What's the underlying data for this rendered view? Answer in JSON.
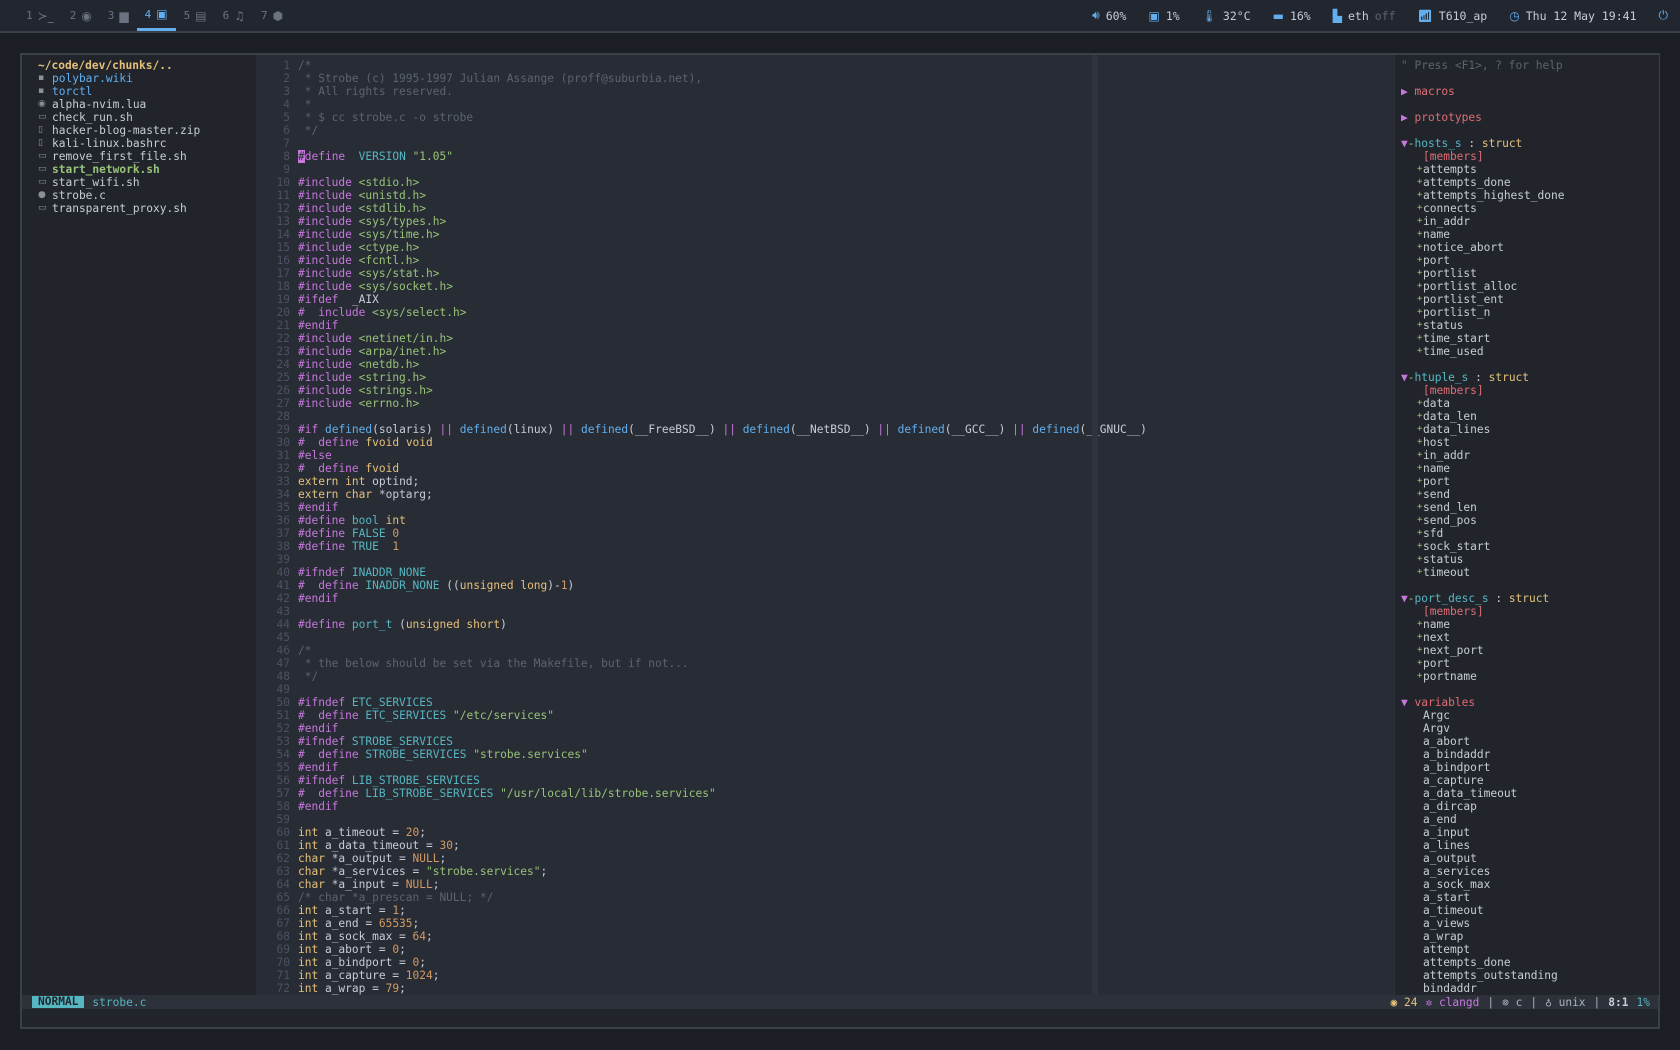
{
  "workspaces": [
    {
      "num": "1",
      "icon": "terminal-icon",
      "glyph": "≻_",
      "active": false
    },
    {
      "num": "2",
      "icon": "firefox-icon",
      "glyph": "◉",
      "active": false
    },
    {
      "num": "3",
      "icon": "folder-icon",
      "glyph": "▆",
      "active": false
    },
    {
      "num": "4",
      "icon": "code-icon",
      "glyph": "▣",
      "active": true
    },
    {
      "num": "5",
      "icon": "book-icon",
      "glyph": "▤",
      "active": false
    },
    {
      "num": "6",
      "icon": "music-icon",
      "glyph": "♫",
      "active": false
    },
    {
      "num": "7",
      "icon": "box-icon",
      "glyph": "⬢",
      "active": false
    }
  ],
  "status": {
    "volume": "60%",
    "cpu": "1%",
    "temp": "32°C",
    "memory": "16%",
    "eth": "eth",
    "eth_state": "off",
    "wifi": "T610_ap",
    "clock": "Thu 12 May 19:41"
  },
  "tree": {
    "root": "~/code/dev/chunks/..",
    "files": [
      {
        "name": "polybar.wiki",
        "icon": "folder-icon",
        "glyph": "▪",
        "style": "c-blue"
      },
      {
        "name": "torctl",
        "icon": "folder-icon",
        "glyph": "▪",
        "style": "c-blue"
      },
      {
        "name": "alpha-nvim.lua",
        "icon": "lua-icon",
        "glyph": "◉",
        "style": "c-white"
      },
      {
        "name": "check_run.sh",
        "icon": "terminal-icon",
        "glyph": "▭",
        "style": "c-white"
      },
      {
        "name": "hacker-blog-master.zip",
        "icon": "file-icon",
        "glyph": "▯",
        "style": "c-white"
      },
      {
        "name": "kali-linux.bashrc",
        "icon": "file-icon",
        "glyph": "▯",
        "style": "c-white"
      },
      {
        "name": "remove_first_file.sh",
        "icon": "terminal-icon",
        "glyph": "▭",
        "style": "c-white"
      },
      {
        "name": "start_network.sh",
        "icon": "terminal-icon",
        "glyph": "▭",
        "style": "c-bold-green"
      },
      {
        "name": "start_wifi.sh",
        "icon": "terminal-icon",
        "glyph": "▭",
        "style": "c-white"
      },
      {
        "name": "strobe.c",
        "icon": "c-file-icon",
        "glyph": "●",
        "style": "c-white"
      },
      {
        "name": "transparent_proxy.sh",
        "icon": "terminal-icon",
        "glyph": "▭",
        "style": "c-white"
      }
    ]
  },
  "code": [
    [
      [
        "cm",
        "/*"
      ]
    ],
    [
      [
        "cm",
        " * Strobe (c) 1995-1997 Julian Assange (proff@suburbia.net),"
      ]
    ],
    [
      [
        "cm",
        " * All rights reserved."
      ]
    ],
    [
      [
        "cm",
        " *"
      ]
    ],
    [
      [
        "cm",
        " * $ cc strobe.c -o strobe"
      ]
    ],
    [
      [
        "cm",
        " */"
      ]
    ],
    [],
    [
      [
        "cursor",
        "#"
      ],
      [
        "kw",
        "define"
      ],
      [
        "",
        "  "
      ],
      [
        "mac",
        "VERSION"
      ],
      [
        "",
        " "
      ],
      [
        "st-s",
        "\"1.05\""
      ]
    ],
    [],
    [
      [
        "kw",
        "#include"
      ],
      [
        "",
        " "
      ],
      [
        "st-s",
        "<stdio.h>"
      ]
    ],
    [
      [
        "kw",
        "#include"
      ],
      [
        "",
        " "
      ],
      [
        "st-s",
        "<unistd.h>"
      ]
    ],
    [
      [
        "kw",
        "#include"
      ],
      [
        "",
        " "
      ],
      [
        "st-s",
        "<stdlib.h>"
      ]
    ],
    [
      [
        "kw",
        "#include"
      ],
      [
        "",
        " "
      ],
      [
        "st-s",
        "<sys/types.h>"
      ]
    ],
    [
      [
        "kw",
        "#include"
      ],
      [
        "",
        " "
      ],
      [
        "st-s",
        "<sys/time.h>"
      ]
    ],
    [
      [
        "kw",
        "#include"
      ],
      [
        "",
        " "
      ],
      [
        "st-s",
        "<ctype.h>"
      ]
    ],
    [
      [
        "kw",
        "#include"
      ],
      [
        "",
        " "
      ],
      [
        "st-s",
        "<fcntl.h>"
      ]
    ],
    [
      [
        "kw",
        "#include"
      ],
      [
        "",
        " "
      ],
      [
        "st-s",
        "<sys/stat.h>"
      ]
    ],
    [
      [
        "kw",
        "#include"
      ],
      [
        "",
        " "
      ],
      [
        "st-s",
        "<sys/socket.h>"
      ]
    ],
    [
      [
        "kw",
        "#ifdef"
      ],
      [
        "",
        "  _AIX"
      ]
    ],
    [
      [
        "kw",
        "#"
      ],
      [
        "",
        "  "
      ],
      [
        "kw",
        "include"
      ],
      [
        "",
        " "
      ],
      [
        "st-s",
        "<sys/select.h>"
      ]
    ],
    [
      [
        "kw",
        "#endif"
      ]
    ],
    [
      [
        "kw",
        "#include"
      ],
      [
        "",
        " "
      ],
      [
        "st-s",
        "<netinet/in.h>"
      ]
    ],
    [
      [
        "kw",
        "#include"
      ],
      [
        "",
        " "
      ],
      [
        "st-s",
        "<arpa/inet.h>"
      ]
    ],
    [
      [
        "kw",
        "#include"
      ],
      [
        "",
        " "
      ],
      [
        "st-s",
        "<netdb.h>"
      ]
    ],
    [
      [
        "kw",
        "#include"
      ],
      [
        "",
        " "
      ],
      [
        "st-s",
        "<string.h>"
      ]
    ],
    [
      [
        "kw",
        "#include"
      ],
      [
        "",
        " "
      ],
      [
        "st-s",
        "<strings.h>"
      ]
    ],
    [
      [
        "kw",
        "#include"
      ],
      [
        "",
        " "
      ],
      [
        "st-s",
        "<errno.h>"
      ]
    ],
    [],
    [
      [
        "kw",
        "#if"
      ],
      [
        "",
        " "
      ],
      [
        "fn",
        "defined"
      ],
      [
        "",
        "(solaris) "
      ],
      [
        "kw",
        "||"
      ],
      [
        "",
        " "
      ],
      [
        "fn",
        "defined"
      ],
      [
        "",
        "(linux) "
      ],
      [
        "kw",
        "||"
      ],
      [
        "",
        " "
      ],
      [
        "fn",
        "defined"
      ],
      [
        "",
        "(__FreeBSD__) "
      ],
      [
        "kw",
        "||"
      ],
      [
        "",
        " "
      ],
      [
        "fn",
        "defined"
      ],
      [
        "",
        "(__NetBSD__) "
      ],
      [
        "kw",
        "||"
      ],
      [
        "",
        " "
      ],
      [
        "fn",
        "defined"
      ],
      [
        "",
        "(__GCC__) "
      ],
      [
        "kw",
        "||"
      ],
      [
        "",
        " "
      ],
      [
        "fn",
        "defined"
      ],
      [
        "",
        "(__GNUC__)"
      ]
    ],
    [
      [
        "kw",
        "#"
      ],
      [
        "",
        "  "
      ],
      [
        "kw",
        "define"
      ],
      [
        "",
        " "
      ],
      [
        "ty",
        "fvoid void"
      ]
    ],
    [
      [
        "kw",
        "#else"
      ]
    ],
    [
      [
        "kw",
        "#"
      ],
      [
        "",
        "  "
      ],
      [
        "kw",
        "define"
      ],
      [
        "",
        " "
      ],
      [
        "ty",
        "fvoid"
      ]
    ],
    [
      [
        "ty",
        "extern"
      ],
      [
        "",
        " "
      ],
      [
        "ty",
        "int"
      ],
      [
        "",
        " optind;"
      ]
    ],
    [
      [
        "ty",
        "extern"
      ],
      [
        "",
        " "
      ],
      [
        "ty",
        "char"
      ],
      [
        "",
        " *optarg;"
      ]
    ],
    [
      [
        "kw",
        "#endif"
      ]
    ],
    [
      [
        "kw",
        "#define"
      ],
      [
        "",
        " "
      ],
      [
        "mac",
        "bool"
      ],
      [
        "",
        " "
      ],
      [
        "ty",
        "int"
      ]
    ],
    [
      [
        "kw",
        "#define"
      ],
      [
        "",
        " "
      ],
      [
        "mac",
        "FALSE"
      ],
      [
        "",
        " "
      ],
      [
        "nm",
        "0"
      ]
    ],
    [
      [
        "kw",
        "#define"
      ],
      [
        "",
        " "
      ],
      [
        "mac",
        "TRUE"
      ],
      [
        "",
        "  "
      ],
      [
        "nm",
        "1"
      ]
    ],
    [],
    [
      [
        "kw",
        "#ifndef"
      ],
      [
        "",
        " "
      ],
      [
        "mac",
        "INADDR_NONE"
      ]
    ],
    [
      [
        "kw",
        "#"
      ],
      [
        "",
        "  "
      ],
      [
        "kw",
        "define"
      ],
      [
        "",
        " "
      ],
      [
        "mac",
        "INADDR_NONE"
      ],
      [
        "",
        " (("
      ],
      [
        "ty",
        "unsigned long"
      ],
      [
        "",
        ")-"
      ],
      [
        "nm",
        "1"
      ],
      [
        "",
        ")"
      ]
    ],
    [
      [
        "kw",
        "#endif"
      ]
    ],
    [],
    [
      [
        "kw",
        "#define"
      ],
      [
        "",
        " "
      ],
      [
        "mac",
        "port_t"
      ],
      [
        "",
        " ("
      ],
      [
        "ty",
        "unsigned short"
      ],
      [
        "",
        ")"
      ]
    ],
    [],
    [
      [
        "cm",
        "/*"
      ]
    ],
    [
      [
        "cm",
        " * the below should be set via the Makefile, but if not..."
      ]
    ],
    [
      [
        "cm",
        " */"
      ]
    ],
    [],
    [
      [
        "kw",
        "#ifndef"
      ],
      [
        "",
        " "
      ],
      [
        "mac",
        "ETC_SERVICES"
      ]
    ],
    [
      [
        "kw",
        "#"
      ],
      [
        "",
        "  "
      ],
      [
        "kw",
        "define"
      ],
      [
        "",
        " "
      ],
      [
        "mac",
        "ETC_SERVICES"
      ],
      [
        "",
        " "
      ],
      [
        "st-s",
        "\"/etc/services\""
      ]
    ],
    [
      [
        "kw",
        "#endif"
      ]
    ],
    [
      [
        "kw",
        "#ifndef"
      ],
      [
        "",
        " "
      ],
      [
        "mac",
        "STROBE_SERVICES"
      ]
    ],
    [
      [
        "kw",
        "#"
      ],
      [
        "",
        "  "
      ],
      [
        "kw",
        "define"
      ],
      [
        "",
        " "
      ],
      [
        "mac",
        "STROBE_SERVICES"
      ],
      [
        "",
        " "
      ],
      [
        "st-s",
        "\"strobe.services\""
      ]
    ],
    [
      [
        "kw",
        "#endif"
      ]
    ],
    [
      [
        "kw",
        "#ifndef"
      ],
      [
        "",
        " "
      ],
      [
        "mac",
        "LIB_STROBE_SERVICES"
      ]
    ],
    [
      [
        "kw",
        "#"
      ],
      [
        "",
        "  "
      ],
      [
        "kw",
        "define"
      ],
      [
        "",
        " "
      ],
      [
        "mac",
        "LIB_STROBE_SERVICES"
      ],
      [
        "",
        " "
      ],
      [
        "st-s",
        "\"/usr/local/lib/strobe.services\""
      ]
    ],
    [
      [
        "kw",
        "#endif"
      ]
    ],
    [],
    [
      [
        "ty",
        "int"
      ],
      [
        "",
        " a_timeout = "
      ],
      [
        "nm",
        "20"
      ],
      [
        "",
        ";"
      ]
    ],
    [
      [
        "ty",
        "int"
      ],
      [
        "",
        " a_data_timeout = "
      ],
      [
        "nm",
        "30"
      ],
      [
        "",
        ";"
      ]
    ],
    [
      [
        "ty",
        "char"
      ],
      [
        "",
        " *a_output = "
      ],
      [
        "nm",
        "NULL"
      ],
      [
        "",
        ";"
      ]
    ],
    [
      [
        "ty",
        "char"
      ],
      [
        "",
        " *a_services = "
      ],
      [
        "st-s",
        "\"strobe.services\""
      ],
      [
        "",
        ";"
      ]
    ],
    [
      [
        "ty",
        "char"
      ],
      [
        "",
        " *a_input = "
      ],
      [
        "nm",
        "NULL"
      ],
      [
        "",
        ";"
      ]
    ],
    [
      [
        "cm",
        "/* char *a_prescan = NULL; */"
      ]
    ],
    [
      [
        "ty",
        "int"
      ],
      [
        "",
        " a_start = "
      ],
      [
        "nm",
        "1"
      ],
      [
        "",
        ";"
      ]
    ],
    [
      [
        "ty",
        "int"
      ],
      [
        "",
        " a_end = "
      ],
      [
        "nm",
        "65535"
      ],
      [
        "",
        ";"
      ]
    ],
    [
      [
        "ty",
        "int"
      ],
      [
        "",
        " a_sock_max = "
      ],
      [
        "nm",
        "64"
      ],
      [
        "",
        ";"
      ]
    ],
    [
      [
        "ty",
        "int"
      ],
      [
        "",
        " a_abort = "
      ],
      [
        "nm",
        "0"
      ],
      [
        "",
        ";"
      ]
    ],
    [
      [
        "ty",
        "int"
      ],
      [
        "",
        " a_bindport = "
      ],
      [
        "nm",
        "0"
      ],
      [
        "",
        ";"
      ]
    ],
    [
      [
        "ty",
        "int"
      ],
      [
        "",
        " a_capture = "
      ],
      [
        "nm",
        "1024"
      ],
      [
        "",
        ";"
      ]
    ],
    [
      [
        "ty",
        "int"
      ],
      [
        "",
        " a_wrap = "
      ],
      [
        "nm",
        "79"
      ],
      [
        "",
        ";"
      ]
    ]
  ],
  "tagbar": {
    "help": "\" Press <F1>, ? for help",
    "collapsed": [
      "macros",
      "prototypes"
    ],
    "structs": [
      {
        "name": "hosts_s",
        "kind": "struct",
        "members_label": "[members]",
        "members": [
          "attempts",
          "attempts_done",
          "attempts_highest_done",
          "connects",
          "in_addr",
          "name",
          "notice_abort",
          "port",
          "portlist",
          "portlist_alloc",
          "portlist_ent",
          "portlist_n",
          "status",
          "time_start",
          "time_used"
        ]
      },
      {
        "name": "htuple_s",
        "kind": "struct",
        "members_label": "[members]",
        "members": [
          "data",
          "data_len",
          "data_lines",
          "host",
          "in_addr",
          "name",
          "port",
          "send",
          "send_len",
          "send_pos",
          "sfd",
          "sock_start",
          "status",
          "timeout"
        ]
      },
      {
        "name": "port_desc_s",
        "kind": "struct",
        "members_label": "[members]",
        "members": [
          "name",
          "next",
          "next_port",
          "port",
          "portname"
        ]
      }
    ],
    "variables_label": "variables",
    "variables": [
      "Argc",
      "Argv",
      "a_abort",
      "a_bindaddr",
      "a_bindport",
      "a_capture",
      "a_data_timeout",
      "a_dircap",
      "a_end",
      "a_input",
      "a_lines",
      "a_output",
      "a_services",
      "a_sock_max",
      "a_start",
      "a_timeout",
      "a_views",
      "a_wrap",
      "attempt",
      "attempts_done",
      "attempts_outstanding",
      "bindaddr"
    ]
  },
  "statusline": {
    "mode": "NORMAL",
    "file": "strobe.c",
    "warnings": "24",
    "lsp": "clangd",
    "filetype": "c",
    "format": "unix",
    "position": "8:1",
    "percent": "1%"
  }
}
